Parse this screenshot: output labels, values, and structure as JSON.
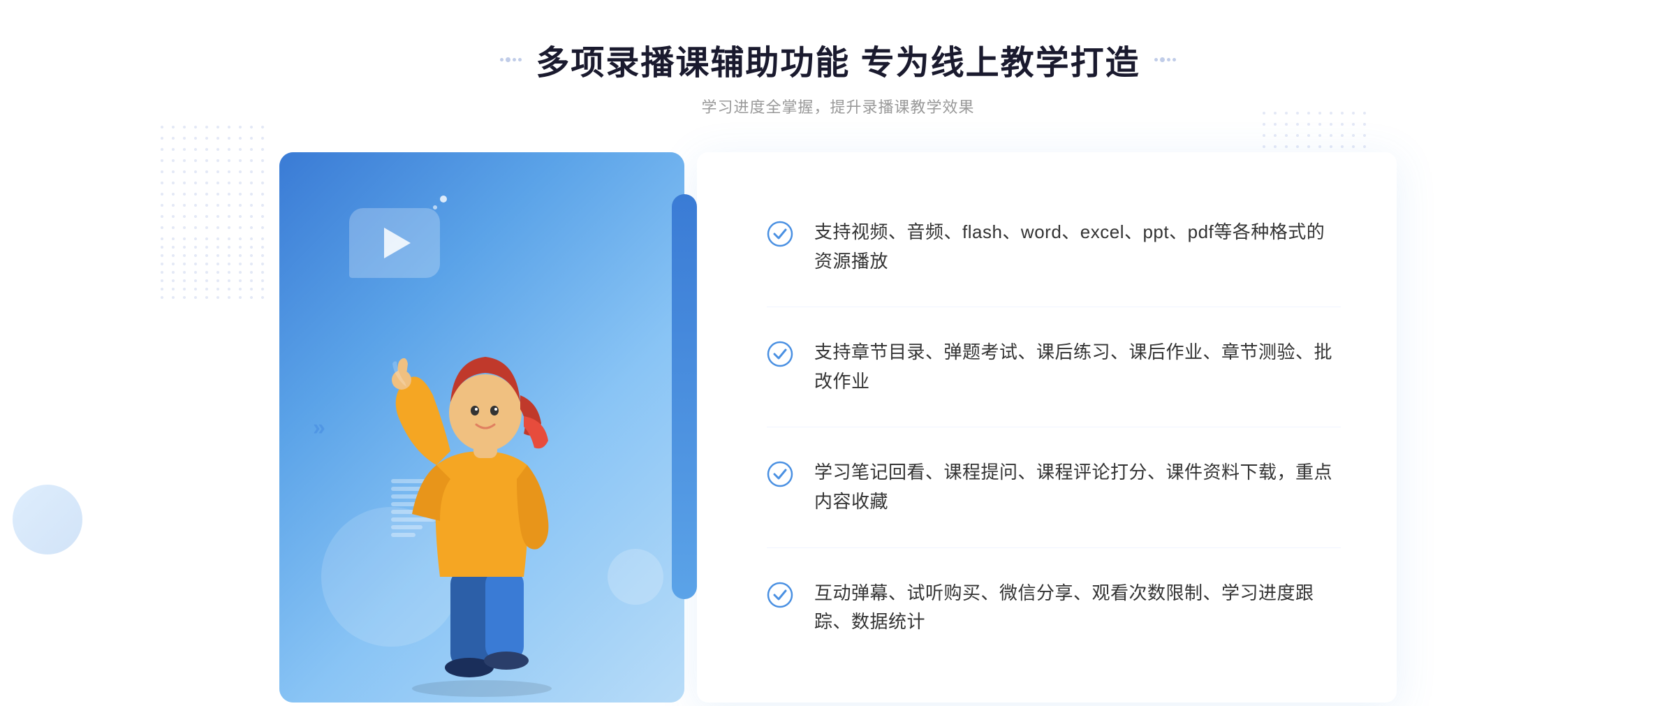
{
  "page": {
    "title": "多项录播课辅助功能 专为线上教学打造",
    "subtitle": "学习进度全掌握，提升录播课教学效果",
    "title_deco_left": ":::",
    "title_deco_right": ":::"
  },
  "features": [
    {
      "id": 1,
      "text": "支持视频、音频、flash、word、excel、ppt、pdf等各种格式的资源播放"
    },
    {
      "id": 2,
      "text": "支持章节目录、弹题考试、课后练习、课后作业、章节测验、批改作业"
    },
    {
      "id": 3,
      "text": "学习笔记回看、课程提问、课程评论打分、课件资料下载，重点内容收藏"
    },
    {
      "id": 4,
      "text": "互动弹幕、试听购买、微信分享、观看次数限制、学习进度跟踪、数据统计"
    }
  ],
  "colors": {
    "primary": "#4a90e2",
    "title": "#1a1a2e",
    "subtitle": "#999999",
    "feature_text": "#333333",
    "divider": "#f0f4ff",
    "gradient_start": "#3a7bd5",
    "gradient_end": "#a8d4f8"
  },
  "icons": {
    "check": "check-circle",
    "play": "play-triangle",
    "arrow_left": "chevron-double-left"
  }
}
